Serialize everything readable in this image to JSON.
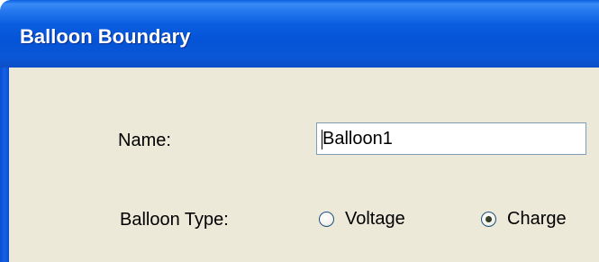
{
  "window": {
    "title": "Balloon Boundary"
  },
  "form": {
    "name_label": "Name:",
    "name_value": "Balloon1",
    "type_label": "Balloon Type:",
    "type_options": [
      {
        "label": "Voltage",
        "selected": false
      },
      {
        "label": "Charge",
        "selected": true
      }
    ]
  },
  "colors": {
    "titlebar_blue": "#0553d6",
    "dialog_background": "#ece9d8",
    "input_border": "#7f9db9"
  }
}
